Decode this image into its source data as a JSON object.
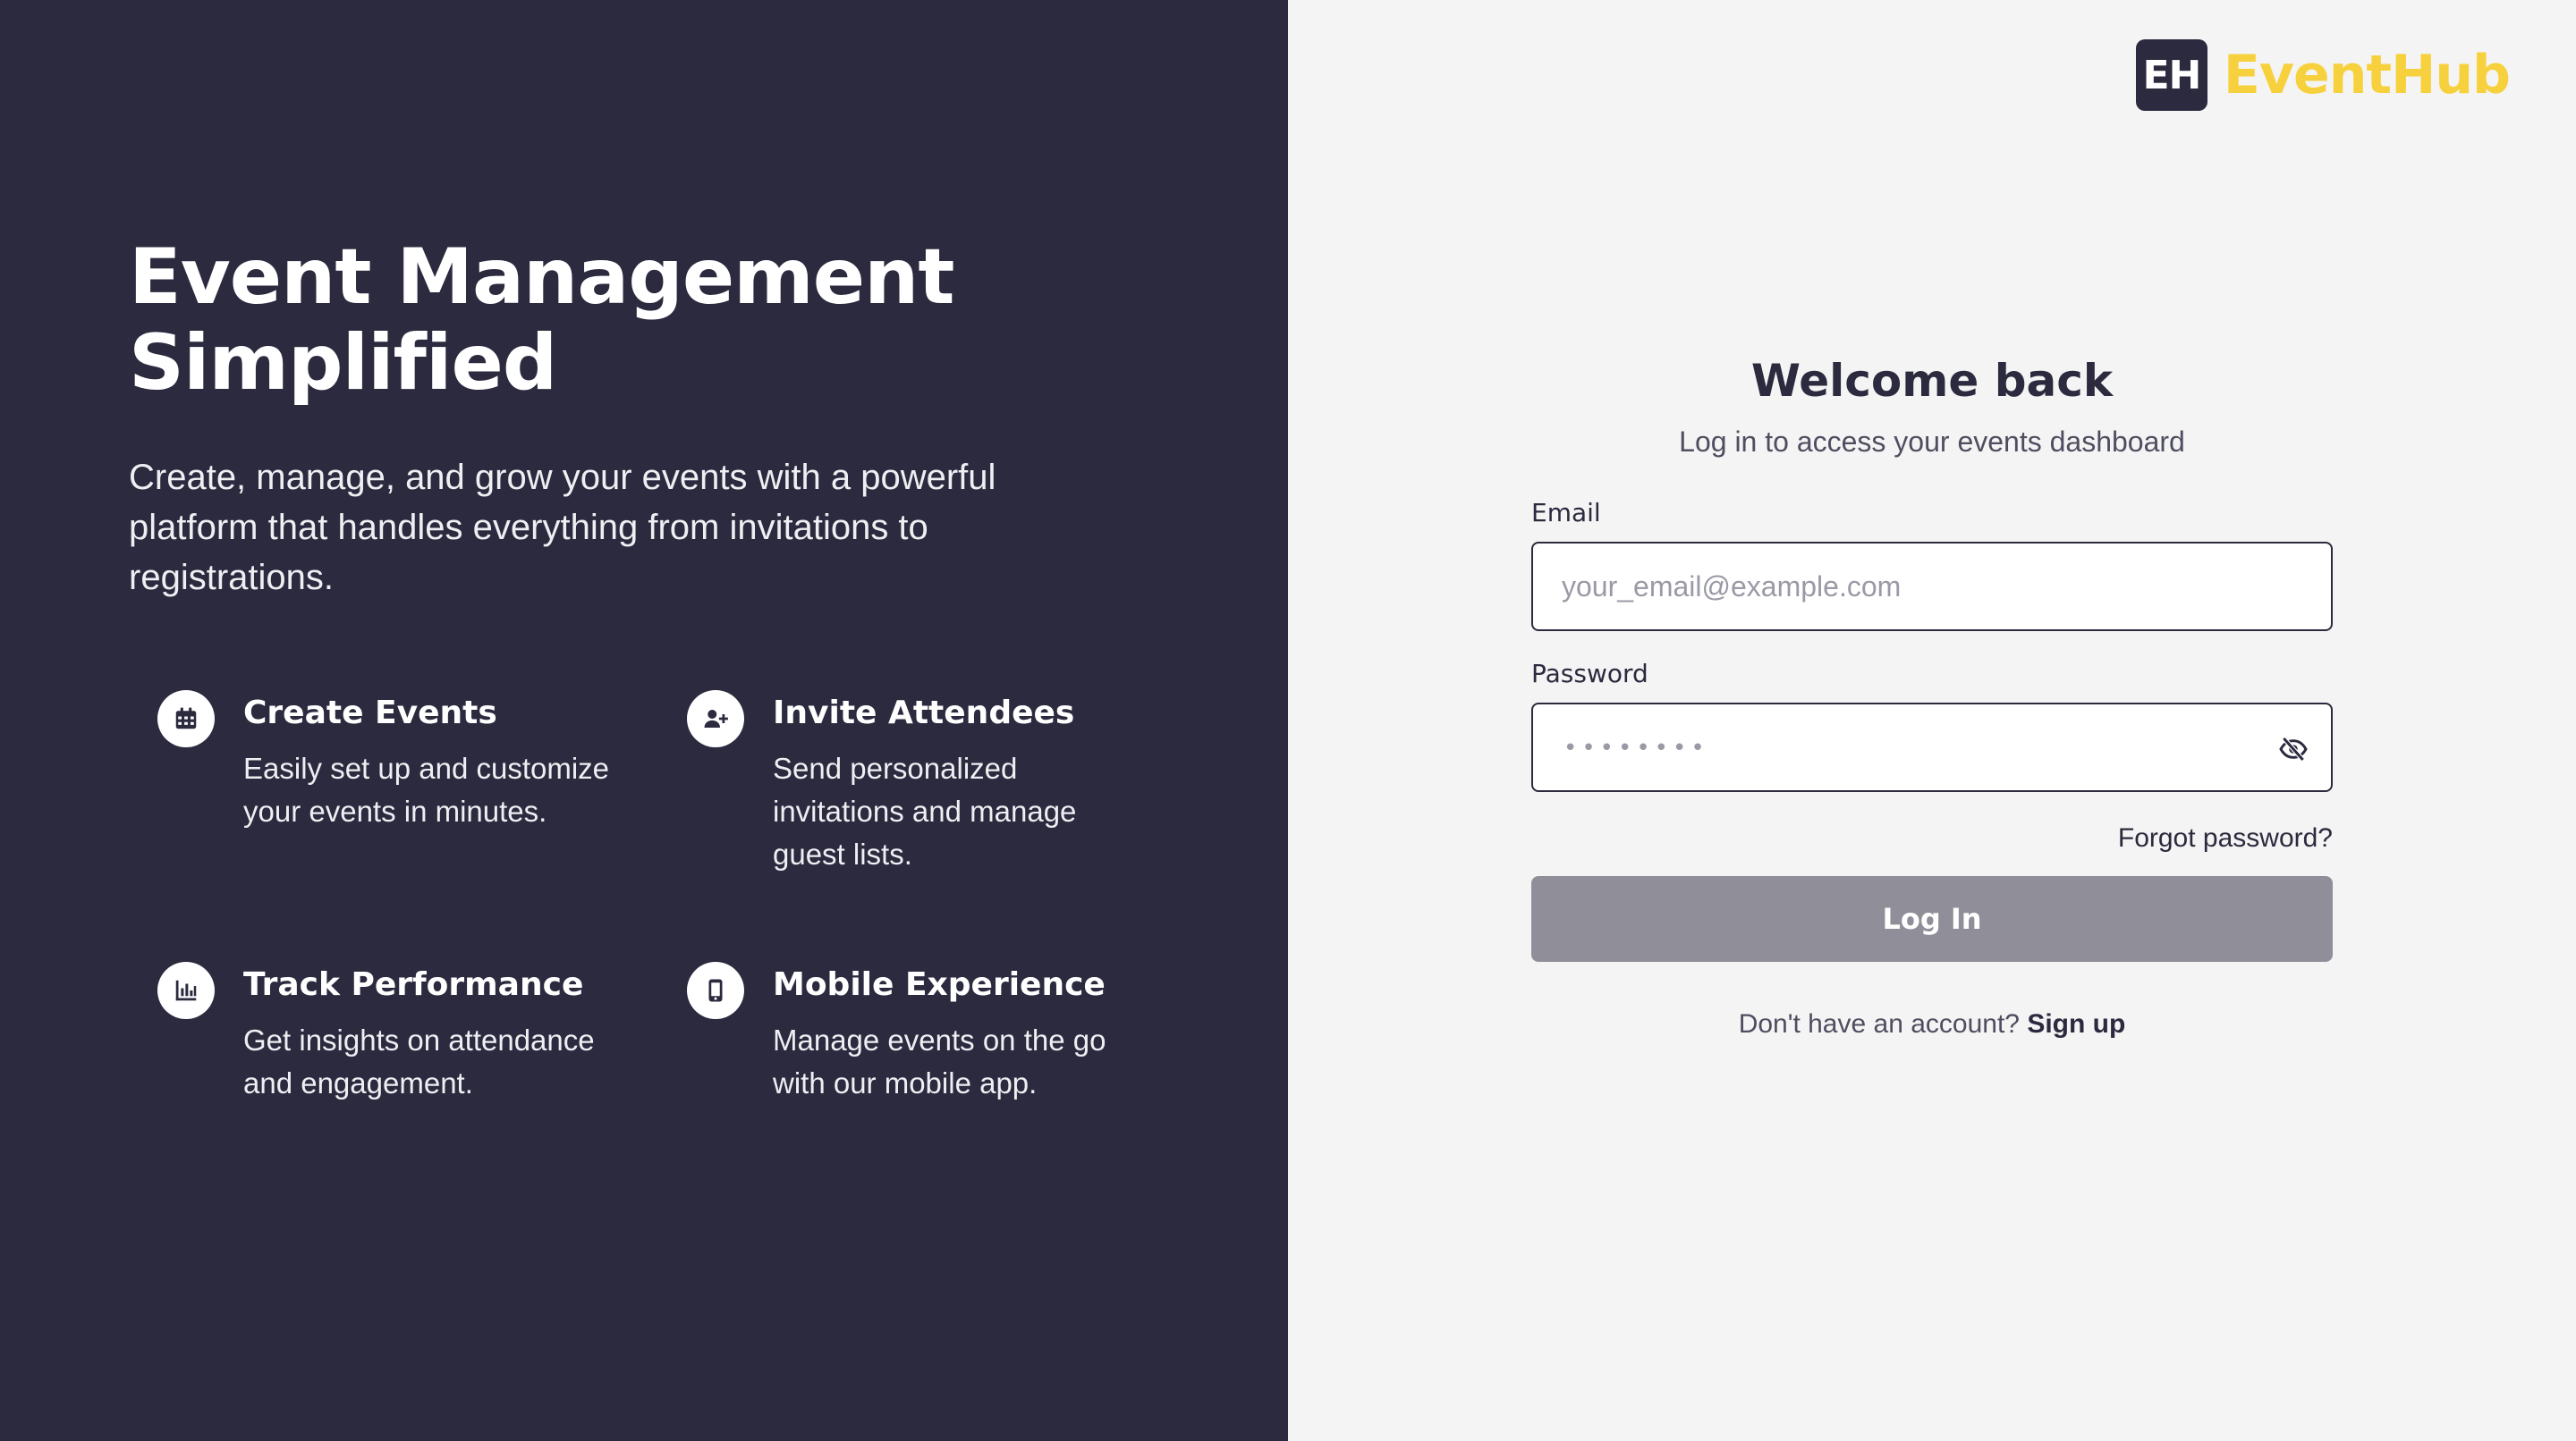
{
  "hero": {
    "title": "Event Management Simplified",
    "subtitle": "Create, manage, and grow your events with a powerful platform that handles everything from invitations to registrations."
  },
  "features": [
    {
      "icon": "calendar-icon",
      "title": "Create Events",
      "description": "Easily set up and customize your events in minutes."
    },
    {
      "icon": "add-user-icon",
      "title": "Invite Attendees",
      "description": "Send personalized invitations and manage guest lists."
    },
    {
      "icon": "bar-chart-icon",
      "title": "Track Performance",
      "description": "Get insights on attendance and engagement."
    },
    {
      "icon": "mobile-phone-icon",
      "title": "Mobile Experience",
      "description": "Manage events on the go with our mobile app."
    }
  ],
  "brand": {
    "mark": "EH",
    "name": "EventHub"
  },
  "login": {
    "heading": "Welcome back",
    "subheading": "Log in to access your events dashboard",
    "email_label": "Email",
    "email_placeholder": "your_email@example.com",
    "email_value": "",
    "password_label": "Password",
    "password_mask": "••••••••",
    "forgot_label": "Forgot password?",
    "submit_label": "Log In",
    "signup_prompt": "Don't have an account?",
    "signup_label": "Sign up"
  },
  "colors": {
    "dark_panel": "#2b2a3e",
    "light_panel": "#f4f4f4",
    "brand_accent": "#f7d13d",
    "button_disabled": "#908f99"
  }
}
